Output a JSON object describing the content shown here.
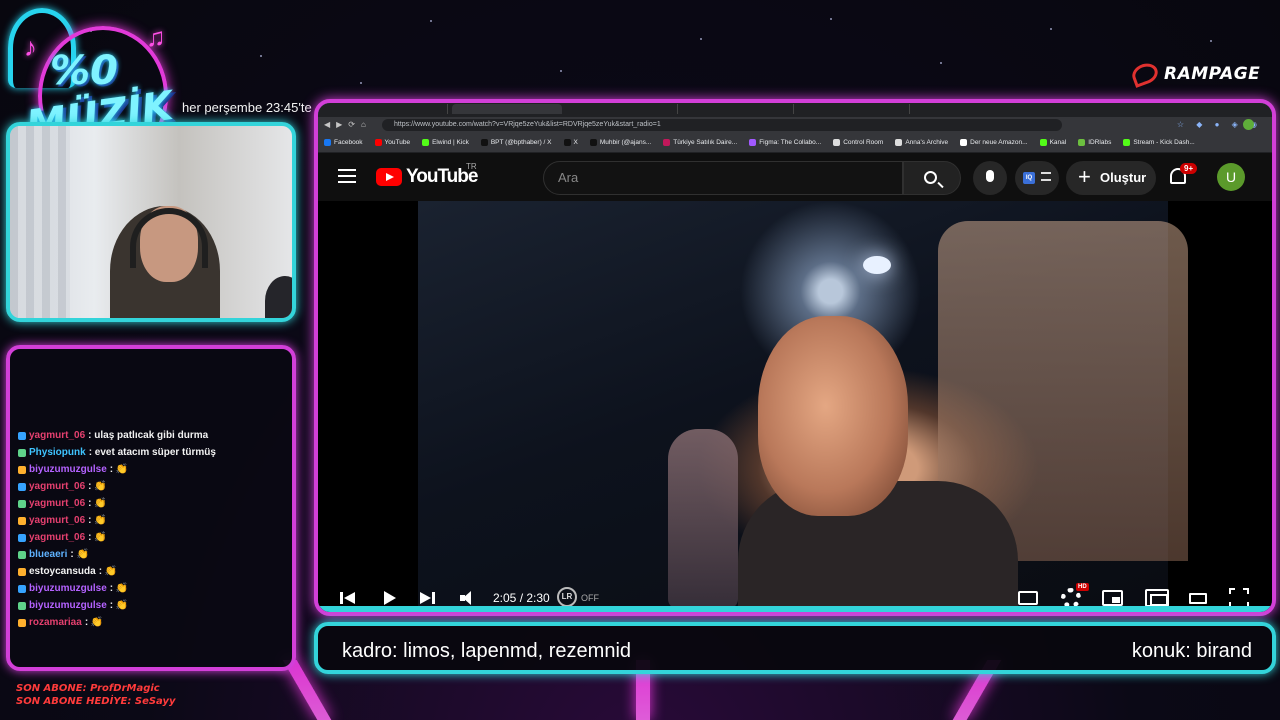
{
  "overlay": {
    "logo": {
      "percent": "%0",
      "word": "MÜZİK"
    },
    "schedule": "her perşembe 23:45'te",
    "brand": "RAMPAGE",
    "lower_left": "kadro: limos, lapenmd, rezemnid",
    "lower_right": "konuk: birand",
    "last_sub": "SON ABONE: ProfDrMagic",
    "last_gift_sub": "SON ABONE HEDİYE: SeSayy"
  },
  "chat": [
    {
      "user": "yagmurt_06",
      "msg": ": ulaş patlıcak gibi durma",
      "color": "#e5406f"
    },
    {
      "user": "Physiopunk",
      "msg": ": evet atacım süper türmüş",
      "color": "#3fc4ff"
    },
    {
      "user": "biyuzumuzgulse",
      "msg": ": 👏",
      "color": "#b462ff"
    },
    {
      "user": "yagmurt_06",
      "msg": ": 👏",
      "color": "#e5406f"
    },
    {
      "user": "yagmurt_06",
      "msg": ": 👏",
      "color": "#e5406f"
    },
    {
      "user": "yagmurt_06",
      "msg": ": 👏",
      "color": "#e5406f"
    },
    {
      "user": "yagmurt_06",
      "msg": ": 👏",
      "color": "#e5406f"
    },
    {
      "user": "blueaeri",
      "msg": ": 👏",
      "color": "#5fb2ff"
    },
    {
      "user": "estoycansuda",
      "msg": ": 👏",
      "color": "#f2f2f2"
    },
    {
      "user": "biyuzumuzgulse",
      "msg": ": 👏",
      "color": "#b462ff"
    },
    {
      "user": "biyuzumuzgulse",
      "msg": ": 👏",
      "color": "#b462ff"
    },
    {
      "user": "rozamariaa",
      "msg": ": 👏",
      "color": "#e5406f"
    }
  ],
  "browser": {
    "url": "https://www.youtube.com/watch?v=VRjqe5zeYuk&list=RDVRjqe5zeYuk&start_radio=1",
    "bookmarks": [
      {
        "label": "Facebook",
        "color": "#1877f2"
      },
      {
        "label": "YouTube",
        "color": "#ff0000"
      },
      {
        "label": "Elwind | Kick",
        "color": "#53fc18"
      },
      {
        "label": "BPT (@bpthaber) / X",
        "color": "#111111"
      },
      {
        "label": "X",
        "color": "#111111"
      },
      {
        "label": "Muhbir (@ajans...",
        "color": "#111111"
      },
      {
        "label": "Türkiye Satılık Daire...",
        "color": "#c2185b"
      },
      {
        "label": "Figma: The Collabo...",
        "color": "#a259ff"
      },
      {
        "label": "Control Room",
        "color": "#dddddd"
      },
      {
        "label": "Anna's Archive",
        "color": "#dddddd"
      },
      {
        "label": "Der neue Amazon...",
        "color": "#ffffff"
      },
      {
        "label": "Kanal",
        "color": "#53fc18"
      },
      {
        "label": "IDRlabs",
        "color": "#6cbf3f"
      },
      {
        "label": "Stream - Kick Dash...",
        "color": "#53fc18"
      }
    ]
  },
  "youtube": {
    "logo": "YouTube",
    "country": "TR",
    "search_placeholder": "Ara",
    "create_label": "Oluştur",
    "notifications": "9+",
    "avatar": "U",
    "time": "2:05 / 2:30",
    "progress": 0.833,
    "lr_label": "LR",
    "lr_state": "OFF",
    "hd_label": "HD"
  }
}
